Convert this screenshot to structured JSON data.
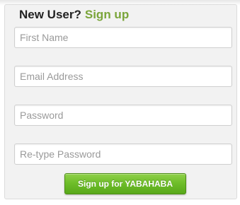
{
  "form": {
    "heading": "New User?",
    "heading_sub": "Sign up",
    "first_name_placeholder": "First Name",
    "email_placeholder": "Email Address",
    "password_placeholder": "Password",
    "retype_password_placeholder": "Re-type Password",
    "submit_label": "Sign up for YABAHABA"
  },
  "colors": {
    "accent_green": "#7aa53a",
    "button_green": "#6fbe2a",
    "panel_bg": "#f2f2f2"
  }
}
